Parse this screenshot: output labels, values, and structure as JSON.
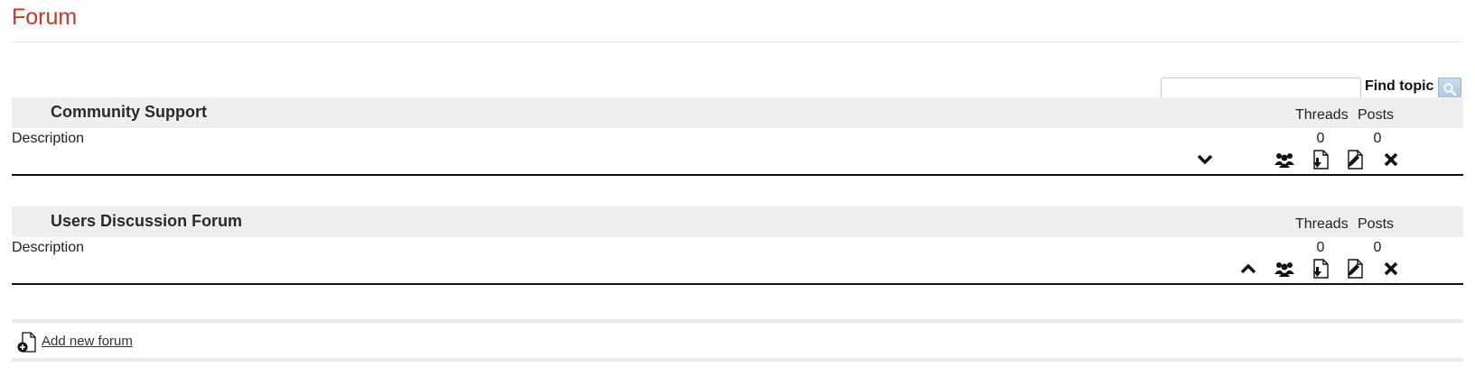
{
  "page": {
    "title": "Forum"
  },
  "search": {
    "placeholder": "",
    "value": "",
    "label": "Find topic",
    "button_icon": "search-icon"
  },
  "columns": {
    "threads": "Threads",
    "posts": "Posts"
  },
  "forums": [
    {
      "name": "Community Support",
      "description": "Description",
      "threads": "0",
      "posts": "0",
      "move_icon": "chevron-down-icon"
    },
    {
      "name": "Users Discussion Forum",
      "description": "Description",
      "threads": "0",
      "posts": "0",
      "move_icon": "chevron-up-icon"
    }
  ],
  "actions": {
    "add_label": "Add new forum"
  },
  "colors": {
    "title": "#c8381c",
    "header_bg": "#efefef",
    "search_button": "#b4cfe3"
  }
}
